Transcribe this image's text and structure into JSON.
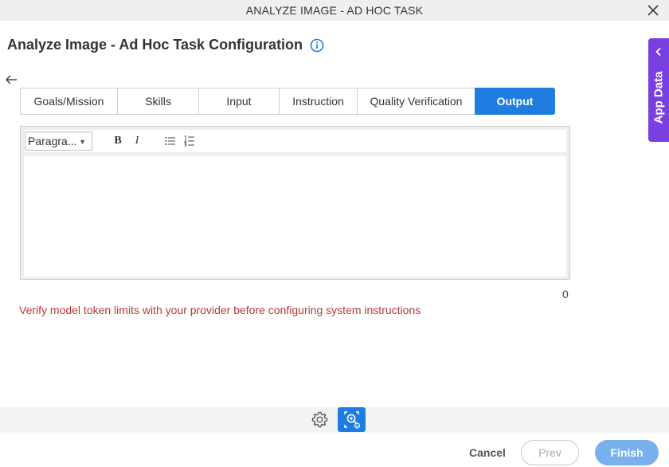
{
  "window": {
    "title": "ANALYZE IMAGE - AD HOC TASK"
  },
  "header": {
    "title": "Analyze Image - Ad Hoc Task Configuration"
  },
  "tabs": [
    {
      "label": "Goals/Mission",
      "active": false
    },
    {
      "label": "Skills",
      "active": false
    },
    {
      "label": "Input",
      "active": false
    },
    {
      "label": "Instruction",
      "active": false
    },
    {
      "label": "Quality Verification",
      "active": false
    },
    {
      "label": "Output",
      "active": true
    }
  ],
  "editor": {
    "format_value": "Paragra...",
    "bold_label": "B",
    "italic_label": "I",
    "content": "",
    "char_count": "0"
  },
  "warning": "Verify model token limits with your provider before configuring system instructions",
  "app_data": {
    "label": "App Data"
  },
  "footer": {
    "cancel": "Cancel",
    "prev": "Prev",
    "finish": "Finish"
  },
  "colors": {
    "accent": "#1f7ce0",
    "app_data": "#7a3fe0",
    "warning": "#b23a3a",
    "finish_disabled": "#79b1ef"
  },
  "icons": [
    "close-icon",
    "info-icon",
    "back-arrow-icon",
    "chevron-left-icon",
    "bulleted-list-icon",
    "numbered-list-icon",
    "gear-icon",
    "ai-image-search-icon"
  ]
}
